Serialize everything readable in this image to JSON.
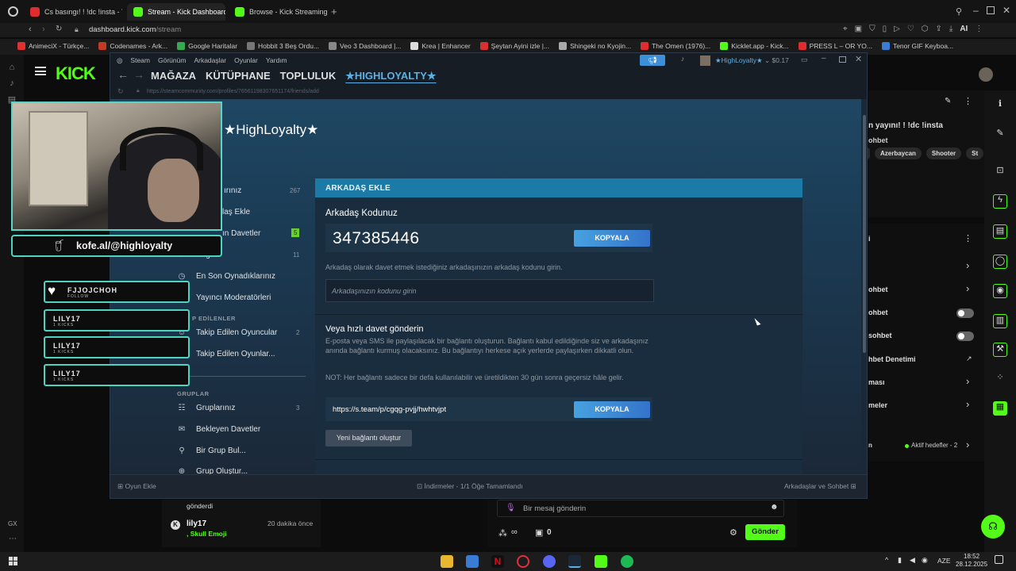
{
  "browser": {
    "tabs": [
      {
        "label": "Cs basıngı! ! !dc !insta - Yo",
        "color": "#e02c2c"
      },
      {
        "label": "Stream - Kick Dashboard",
        "color": "#53fc18"
      },
      {
        "label": "Browse - Kick Streaming",
        "color": "#53fc18"
      }
    ],
    "new_tab": "+",
    "address": "dashboard.kick.com/stream",
    "address_host": "dashboard.kick.com",
    "address_path": "/stream",
    "bookmarks": [
      {
        "label": "AnimeciX - Türkçe...",
        "color": "#e03131"
      },
      {
        "label": "Codenames - Ark...",
        "color": "#c23b22"
      },
      {
        "label": "Google Haritalar",
        "color": "#34a853"
      },
      {
        "label": "Hobbit 3 Beş Ordu...",
        "color": "#777777"
      },
      {
        "label": "Veo 3 Dashboard |...",
        "color": "#888888"
      },
      {
        "label": "Krea | Enhancer",
        "color": "#dddddd"
      },
      {
        "label": "Şeytan Ayini izle |...",
        "color": "#d63031"
      },
      {
        "label": "Shingeki no Kyojin...",
        "color": "#aaaaaa"
      },
      {
        "label": "The Omen (1976)...",
        "color": "#e02c2c"
      },
      {
        "label": "Kicklet.app - Kick...",
        "color": "#53fc18"
      },
      {
        "label": "PRESS L – OR YO...",
        "color": "#e02c2c"
      },
      {
        "label": "Tenor GIF Keyboa...",
        "color": "#3a7bd5"
      }
    ],
    "ai_label": "AI"
  },
  "kick": {
    "logo": "KICK",
    "stream_title": "n yayını! ! !dc !insta",
    "sohbet_label": "ohbet",
    "tags": [
      "Azerbaycan",
      "Shooter",
      "St"
    ],
    "settings_rows": [
      {
        "label": "ohbet",
        "control": "chevron"
      },
      {
        "label": "ohbet",
        "control": "toggle"
      },
      {
        "label": "sohbet",
        "control": "toggle"
      },
      {
        "label": "hbet Denetimi",
        "control": "external"
      },
      {
        "label": "ması",
        "control": "chevron"
      },
      {
        "label": "meler",
        "control": "chevron"
      }
    ],
    "goals_short": "n",
    "goals_status": "Aktif hedefler - 2",
    "chat_partial": "gönderdi",
    "chat_user": "lily17",
    "chat_time": "20 dakika önce",
    "chat_message": ", Skull Emoji",
    "chat_input_placeholder": "Bir mesaj gönderin",
    "infinity_label": "∞",
    "zero_label": "0",
    "send_label": "Gönder"
  },
  "overlay": {
    "social": "kofe.al/@highloyalty",
    "alerts": [
      {
        "name": "FJJOJCHOH",
        "sub": "FOLLOW"
      },
      {
        "name": "LILY17",
        "sub": "1 KICKS"
      },
      {
        "name": "LILY17",
        "sub": "1 KICKS"
      },
      {
        "name": "LILY17",
        "sub": "1 KICKS"
      }
    ]
  },
  "steam": {
    "menu": [
      "Steam",
      "Görünüm",
      "Arkadaşlar",
      "Oyunlar",
      "Yardım"
    ],
    "nav": [
      "MAĞAZA",
      "KÜTÜPHANE",
      "TOPLULUK",
      "★HIGHLOYALTY★"
    ],
    "username": "★HighLoyalty★",
    "balance": "$0.17",
    "url": "https://steamcommunity.com/profiles/76561198307651174/friends/add",
    "profile_name": "★HighLoyalty★",
    "friends_links": [
      {
        "label": "ırınız",
        "count": "267",
        "icon": ""
      },
      {
        "label": "laş Ekle",
        "count": "",
        "icon": ""
      },
      {
        "label": "ın Davetler",
        "count": "5",
        "icon": ""
      },
      {
        "label": "Engelli",
        "count": "11",
        "icon": "⊘"
      },
      {
        "label": "En Son Oynadıklarınız",
        "count": "",
        "icon": "◷"
      },
      {
        "label": "Yayıncı Moderatörleri",
        "count": "",
        "icon": "◉"
      }
    ],
    "followed_header": "P EDİLENLER",
    "followed_links": [
      {
        "label": "Takip Edilen Oyuncular",
        "count": "2",
        "icon": "☺"
      },
      {
        "label": "Takip Edilen Oyunlar...",
        "count": "",
        "icon": "◻"
      }
    ],
    "groups_header": "GRUPLAR",
    "group_links": [
      {
        "label": "Gruplarınız",
        "count": "3",
        "icon": "☷"
      },
      {
        "label": "Bekleyen Davetler",
        "count": "",
        "icon": "✉"
      },
      {
        "label": "Bir Grup Bul...",
        "count": "",
        "icon": "⚲"
      },
      {
        "label": "Grup Oluştur...",
        "count": "",
        "icon": "⊕"
      }
    ],
    "panel_title": "ARKADAŞ EKLE",
    "code_heading": "Arkadaş Kodunuz",
    "friend_code": "347385446",
    "copy_label": "KOPYALA",
    "code_help": "Arkadaş olarak davet etmek istediğiniz arkadaşınızın arkadaş kodunu girin.",
    "code_input_placeholder": "Arkadaşınızın kodunu girin",
    "quick_heading": "Veya hızlı davet gönderin",
    "quick_desc": "E-posta veya SMS ile paylaşılacak bir bağlantı oluşturun. Bağlantı kabul edildiğinde siz ve arkadaşınız anında bağlantı kurmuş olacaksınız. Bu bağlantıyı herkese açık yerlerde paylaşırken dikkatli olun.",
    "quick_note": "NOT: Her bağlantı sadece bir defa kullanılabilir ve üretildikten 30 gün sonra geçersiz hâle gelir.",
    "invite_link": "https://s.team/p/cgqg-pvjj/hwhtvjpt",
    "new_link_label": "Yeni bağlantı oluştur",
    "add_game": "Oyun Ekle",
    "downloads": "İndirmeler - 1/1 Öğe Tamamlandı",
    "friends_chat": "Arkadaşlar ve Sohbet"
  },
  "taskbar": {
    "left_gx": "GX",
    "lang": "AZE",
    "time": "18:52",
    "date": "28.12.2025"
  },
  "colors": {
    "kick_green": "#53fc18",
    "steam_blue": "#1b7aa6",
    "steam_button": "#3473ca",
    "overlay_teal": "#4fd3c1"
  }
}
